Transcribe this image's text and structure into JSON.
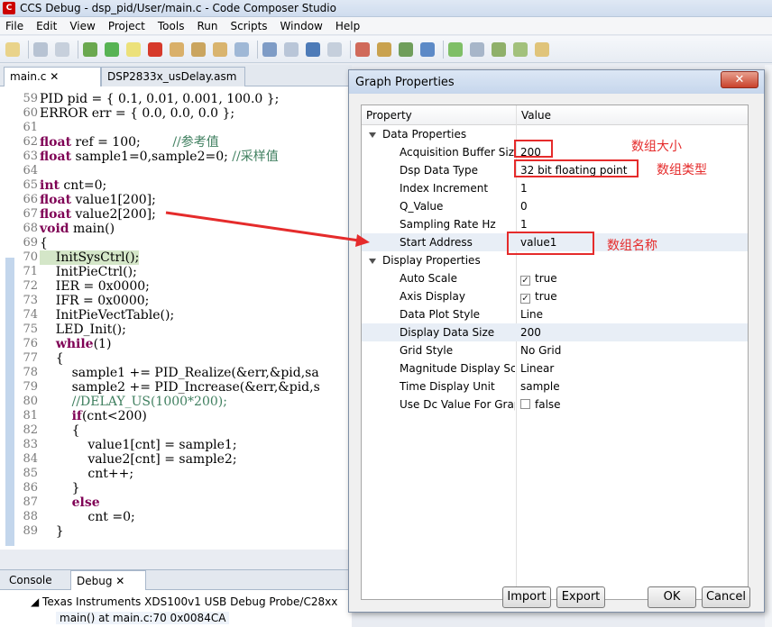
{
  "window": {
    "title": "CCS Debug - dsp_pid/User/main.c - Code Composer Studio"
  },
  "menu": [
    "File",
    "Edit",
    "View",
    "Project",
    "Tools",
    "Run",
    "Scripts",
    "Window",
    "Help"
  ],
  "editor_tabs": [
    {
      "label": "main.c"
    },
    {
      "label": "DSP2833x_usDelay.asm"
    }
  ],
  "code_lines": [
    {
      "n": "59",
      "text": "PID pid = { 0.1, 0.01, 0.001, 100.0 };"
    },
    {
      "n": "60",
      "text": "ERROR err = { 0.0, 0.0, 0.0 };"
    },
    {
      "n": "61",
      "text": ""
    },
    {
      "n": "62",
      "kw": "float",
      "text": " ref = 100;        ",
      "comment": "//参考值"
    },
    {
      "n": "63",
      "kw": "float",
      "text": " sample1=0,sample2=0; ",
      "comment": "//采样值"
    },
    {
      "n": "64",
      "text": ""
    },
    {
      "n": "65",
      "kw": "int",
      "text": " cnt=0;"
    },
    {
      "n": "66",
      "kw": "float",
      "text": " value1[200];"
    },
    {
      "n": "67",
      "kw": "float",
      "text": " value2[200];"
    },
    {
      "n": "68",
      "kw": "void",
      "text": " main()"
    },
    {
      "n": "69",
      "text": "{"
    },
    {
      "n": "70",
      "text": "    InitSysCtrl();",
      "highlight": true
    },
    {
      "n": "71",
      "text": "    InitPieCtrl();"
    },
    {
      "n": "72",
      "text": "    IER = 0x0000;"
    },
    {
      "n": "73",
      "text": "    IFR = 0x0000;"
    },
    {
      "n": "74",
      "text": "    InitPieVectTable();"
    },
    {
      "n": "75",
      "text": "    LED_Init();"
    },
    {
      "n": "76",
      "pre": "    ",
      "kw": "while",
      "text": "(1)"
    },
    {
      "n": "77",
      "text": "    {"
    },
    {
      "n": "78",
      "text": "        sample1 += PID_Realize(&err,&pid,sa"
    },
    {
      "n": "79",
      "text": "        sample2 += PID_Increase(&err,&pid,s"
    },
    {
      "n": "80",
      "pre": "        ",
      "comment": "//DELAY_US(1000*200);"
    },
    {
      "n": "81",
      "pre": "        ",
      "kw": "if",
      "text": "(cnt<200)"
    },
    {
      "n": "82",
      "text": "        {"
    },
    {
      "n": "83",
      "text": "            value1[cnt] = sample1;"
    },
    {
      "n": "84",
      "text": "            value2[cnt] = sample2;"
    },
    {
      "n": "85",
      "text": "            cnt++;"
    },
    {
      "n": "86",
      "text": "        }"
    },
    {
      "n": "87",
      "pre": "        ",
      "kw": "else",
      "text": ""
    },
    {
      "n": "88",
      "text": "            cnt =0;"
    },
    {
      "n": "89",
      "text": "    }"
    }
  ],
  "bottom_tabs": [
    {
      "label": "Console"
    },
    {
      "label": "Debug"
    }
  ],
  "debug_tree": {
    "probe": "Texas Instruments XDS100v1 USB Debug Probe/C28xx",
    "frame": "main() at main.c:70 0x0084CA"
  },
  "dialog": {
    "title": "Graph Properties",
    "close": "✕",
    "col_property": "Property",
    "col_value": "Value",
    "sections": [
      {
        "name": "Data Properties",
        "rows": [
          {
            "name": "Acquisition Buffer Size",
            "value": "200"
          },
          {
            "name": "Dsp Data Type",
            "value": "32 bit floating point"
          },
          {
            "name": "Index Increment",
            "value": "1"
          },
          {
            "name": "Q_Value",
            "value": "0"
          },
          {
            "name": "Sampling Rate Hz",
            "value": "1"
          },
          {
            "name": "Start Address",
            "value": "value1",
            "selected": true
          }
        ]
      },
      {
        "name": "Display Properties",
        "rows": [
          {
            "name": "Auto Scale",
            "value": "true",
            "checkbox": true,
            "checked": true
          },
          {
            "name": "Axis Display",
            "value": "true",
            "checkbox": true,
            "checked": true
          },
          {
            "name": "Data Plot Style",
            "value": "Line"
          },
          {
            "name": "Display Data Size",
            "value": "200",
            "selected": true
          },
          {
            "name": "Grid Style",
            "value": "No Grid"
          },
          {
            "name": "Magnitude Display Scale",
            "value": "Linear"
          },
          {
            "name": "Time Display Unit",
            "value": "sample"
          },
          {
            "name": "Use Dc Value For Graph",
            "value": "false",
            "checkbox": true,
            "checked": false
          }
        ]
      }
    ],
    "buttons": {
      "import": "Import",
      "export": "Export",
      "ok": "OK",
      "cancel": "Cancel"
    }
  },
  "annotations": {
    "buffer_size": "数组大小",
    "data_type": "数组类型",
    "array_name": "数组名称",
    "color": "#e52b2b"
  }
}
